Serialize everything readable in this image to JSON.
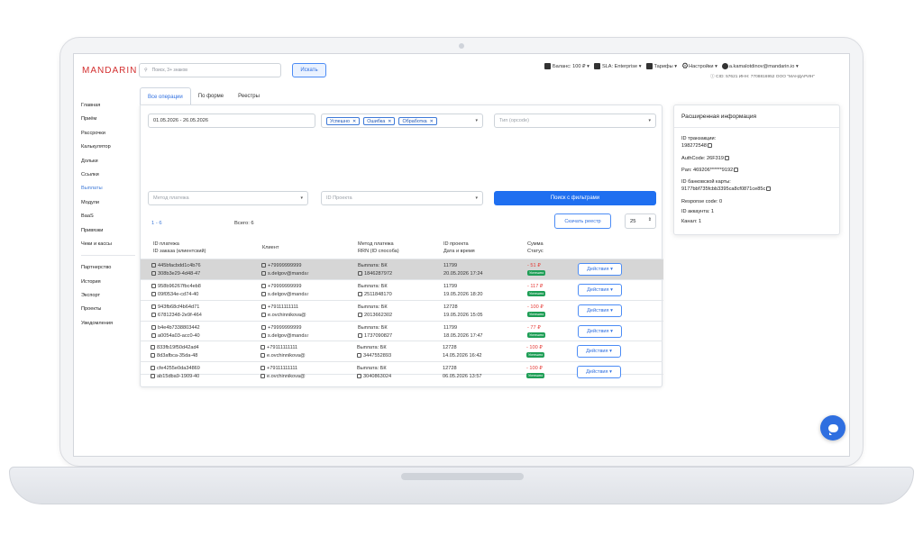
{
  "header": {
    "logo": "MANDARIN",
    "search_placeholder": "Поиск, 3+ знаков",
    "search_button": "Искать",
    "balance": "Баланс: 100 ₽ ▾",
    "sla": "SLA: Enterprise ▾",
    "tariffs": "Тарифы ▾",
    "settings": "Настройки ▾",
    "user": "a.kamalotdinov@mandarin.io ▾",
    "company_info": "CID: 57621  ИНН: 7708816952  ООО \"МАНДАРИН\""
  },
  "sidebar": {
    "items": [
      "Главная",
      "Приём",
      "Рассрочки",
      "Калькулятор",
      "Дольки",
      "Ссылки",
      "Выплаты",
      "Модули",
      "BaaS",
      "Привязки",
      "Чеки и кассы"
    ],
    "items2": [
      "Партнерство",
      "История",
      "Экспорт",
      "Проекты",
      "Уведомления"
    ],
    "active": "Выплаты"
  },
  "tabs": [
    "Все операции",
    "По форме",
    "Реестры"
  ],
  "filters": {
    "date_range": "01.05.2026 - 26.05.2026",
    "status_chips": [
      "Успешно",
      "Ошибка",
      "Обработка"
    ],
    "type_placeholder": "Тип (opcode)",
    "method_placeholder": "Метод платежа",
    "project_placeholder": "ID Проекта",
    "search_button": "Поиск с фильтрами"
  },
  "pagination": {
    "range": "1 - 6",
    "total": "Всего: 6",
    "download": "Скачать реестр",
    "per_page": "25"
  },
  "table": {
    "headers": {
      "col1a": "ID платежа",
      "col1b": "ID заказа (клиентский)",
      "col2": "Клиент",
      "col3a": "Метод платежа",
      "col3b": "RRN (ID способа)",
      "col4a": "ID проекта",
      "col4b": "Дата и время",
      "col5a": "Сумма",
      "col5b": "Статус"
    },
    "rows": [
      {
        "pay_id": "445bfacbdd1c4b76",
        "order_id": "308b3e29-4d48-47",
        "phone": "+79999999999",
        "email": "s.delgov@mandar",
        "method": "Выплата: БК",
        "rrn": "1846287972",
        "project": "11799",
        "date": "20.05.2026 17:24",
        "amount": "- 51 ₽",
        "status": "Успешно",
        "action": "Действия ▾"
      },
      {
        "pay_id": "958b96267fbc4eb8",
        "order_id": "09f0534e-cd74-40",
        "phone": "+79999999999",
        "email": "s.delgov@mandar",
        "method": "Выплата: БК",
        "rrn": "2511848170",
        "project": "11799",
        "date": "19.05.2026 18:20",
        "amount": "- 117 ₽",
        "status": "Успешно",
        "action": "Действия ▾"
      },
      {
        "pay_id": "943fb68cf4b64d71",
        "order_id": "67812348-2e9f-464",
        "phone": "+79111111111",
        "email": "e.ovchinnikova@",
        "method": "Выплата: БК",
        "rrn": "2013662302",
        "project": "12728",
        "date": "19.05.2026 15:05",
        "amount": "- 100 ₽",
        "status": "Успешно",
        "action": "Действия ▾"
      },
      {
        "pay_id": "b4e4b7338803442",
        "order_id": "a0054a03-acc0-40",
        "phone": "+79999999999",
        "email": "s.delgov@mandar",
        "method": "Выплата: БК",
        "rrn": "1737090827",
        "project": "11799",
        "date": "18.05.2026 17:47",
        "amount": "- 77 ₽",
        "status": "Успешно",
        "action": "Действия ▾"
      },
      {
        "pay_id": "833fb19f50d42ad4",
        "order_id": "8d3afbca-35da-48",
        "phone": "+79111111111",
        "email": "e.ovchinnikova@",
        "method": "Выплата: БК",
        "rrn": "3447552893",
        "project": "12728",
        "date": "14.05.2026 16:42",
        "amount": "- 100 ₽",
        "status": "Успешно",
        "action": "Действия ▾"
      },
      {
        "pay_id": "cfe4255e0da34869",
        "order_id": "ab15dba9-1909-40",
        "phone": "+79111111111",
        "email": "e.ovchinnikova@",
        "method": "Выплата: БК",
        "rrn": "3040863024",
        "project": "12728",
        "date": "06.05.2026 13:57",
        "amount": "- 100 ₽",
        "status": "Успешно",
        "action": "Действия ▾"
      }
    ]
  },
  "info_panel": {
    "title": "Расширенная информация",
    "txn_label": "ID транзакции:",
    "txn_value": "198272548",
    "authcode": "AuthCode: 26F319",
    "pan": "Pan:  469206******9192",
    "card_label": "ID банковской карты:",
    "card_value": "9177bbf735fcbb3395ca8cf0871ce85c",
    "response": "Response code:  0",
    "account": "ID аккаунта:  1",
    "channel": "Канал:  1"
  },
  "colors": {
    "accent": "#1f6ff0",
    "logo": "#d32f2f",
    "success": "#1e9e56",
    "negative": "#e53935"
  }
}
